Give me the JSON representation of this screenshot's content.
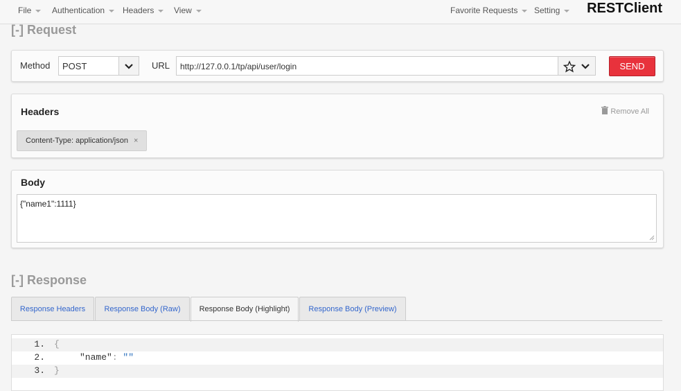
{
  "menu": {
    "file": "File",
    "authentication": "Authentication",
    "headers": "Headers",
    "view": "View",
    "favorite": "Favorite Requests",
    "setting": "Setting"
  },
  "brand": "RESTClient",
  "request": {
    "title": "[-] Request",
    "method_label": "Method",
    "method_value": "POST",
    "url_label": "URL",
    "url_value": "http://127.0.0.1/tp/api/user/login",
    "send_label": "SEND"
  },
  "headers_panel": {
    "title": "Headers",
    "remove_all": "Remove All",
    "tags": [
      {
        "text": "Content-Type: application/json"
      }
    ]
  },
  "body_panel": {
    "title": "Body",
    "content": "{\"name1\":1111}"
  },
  "response": {
    "title": "[-] Response",
    "tabs": [
      {
        "label": "Response Headers"
      },
      {
        "label": "Response Body (Raw)"
      },
      {
        "label": "Response Body (Highlight)"
      },
      {
        "label": "Response Body (Preview)"
      }
    ],
    "lines": [
      {
        "num": "1.",
        "text": "{"
      },
      {
        "num": "2.",
        "key": "\"name\"",
        "colon": ": ",
        "value": "\"\""
      },
      {
        "num": "3.",
        "text": "}"
      }
    ]
  },
  "colors": {
    "send_button": "#e8323c",
    "tab_link": "#3366cc",
    "string_value": "#2a6fbd"
  }
}
